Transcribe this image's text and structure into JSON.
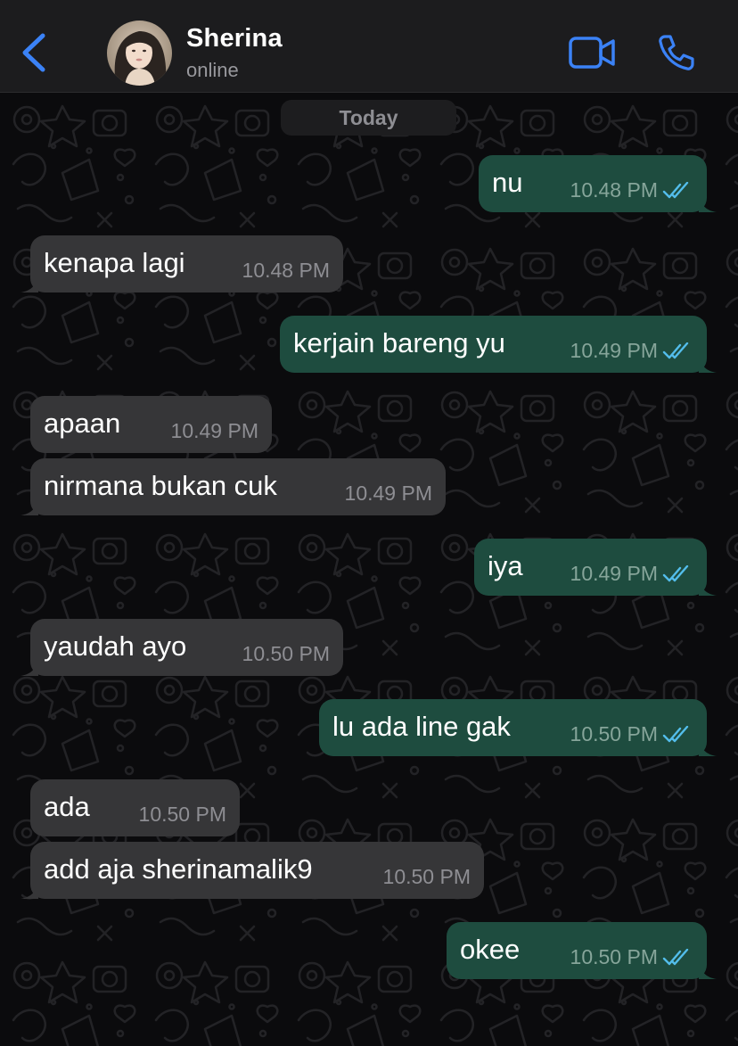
{
  "header": {
    "contact_name": "Sherina",
    "status": "online",
    "back_icon": "chevron-left-icon",
    "video_icon": "video-camera-icon",
    "call_icon": "phone-icon",
    "accent_color": "#3b82f6"
  },
  "day_separator": "Today",
  "colors": {
    "incoming_bubble": "#363638",
    "outgoing_bubble": "#1e4c3f",
    "read_ticks": "#53bdeb"
  },
  "messages": [
    {
      "direction": "out",
      "text": "nu",
      "time": "10.48 PM",
      "status": "read"
    },
    {
      "direction": "in",
      "text": "kenapa lagi",
      "time": "10.48 PM"
    },
    {
      "direction": "out",
      "text": "kerjain bareng yu",
      "time": "10.49 PM",
      "status": "read"
    },
    {
      "direction": "in",
      "text": "apaan",
      "time": "10.49 PM"
    },
    {
      "direction": "in",
      "text": "nirmana bukan cuk",
      "time": "10.49 PM"
    },
    {
      "direction": "out",
      "text": "iya",
      "time": "10.49 PM",
      "status": "read"
    },
    {
      "direction": "in",
      "text": "yaudah ayo",
      "time": "10.50 PM"
    },
    {
      "direction": "out",
      "text": "lu ada line gak",
      "time": "10.50 PM",
      "status": "read"
    },
    {
      "direction": "in",
      "text": "ada",
      "time": "10.50 PM"
    },
    {
      "direction": "in",
      "text": "add aja sherinamalik9",
      "time": "10.50 PM"
    },
    {
      "direction": "out",
      "text": "okee",
      "time": "10.50 PM",
      "status": "read"
    }
  ]
}
